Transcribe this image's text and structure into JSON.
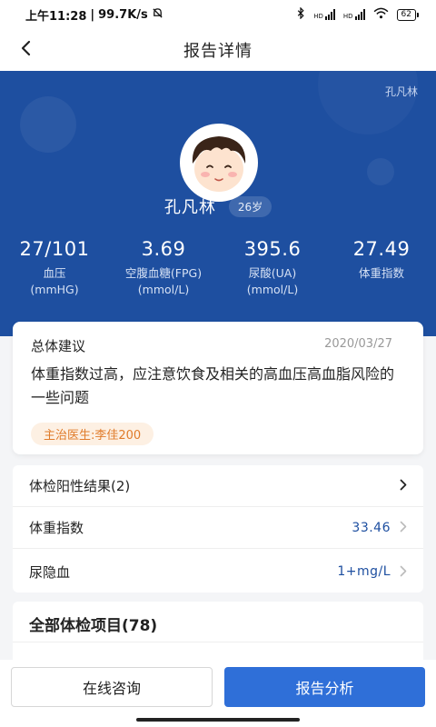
{
  "status_bar": {
    "time": "上午11:28",
    "speed": "99.7K/s",
    "signal1_label": "HD",
    "signal2_label": "HD",
    "battery": "62"
  },
  "nav": {
    "title": "报告详情"
  },
  "profile": {
    "corner_name": "孔凡林",
    "name": "孔凡林",
    "age": "26岁"
  },
  "metrics": [
    {
      "value": "27/101",
      "label": "血压",
      "unit": "(mmHG)"
    },
    {
      "value": "3.69",
      "label": "空腹血糖(FPG)",
      "unit": "(mmol/L)"
    },
    {
      "value": "395.6",
      "label": "尿酸(UA)",
      "unit": "(mmol/L)"
    },
    {
      "value": "27.49",
      "label": "体重指数",
      "unit": ""
    }
  ],
  "advice": {
    "title": "总体建议",
    "date": "2020/03/27",
    "text": "体重指数过高，应注意饮食及相关的高血压高血脂风险的一些问题",
    "doctor": "主治医生:李佳200"
  },
  "results": {
    "positive_label": "体检阳性结果(2)",
    "items": [
      {
        "label": "体重指数",
        "value": "33.46"
      },
      {
        "label": "尿隐血",
        "value": "1+mg/L"
      }
    ]
  },
  "all_items": {
    "title": "全部体检项目(78)"
  },
  "actions": {
    "consult": "在线咨询",
    "analysis": "报告分析"
  },
  "colors": {
    "hero_bg": "#1e4fa0",
    "primary": "#2f6fd8",
    "doctor_tag": "#e07b2a"
  }
}
